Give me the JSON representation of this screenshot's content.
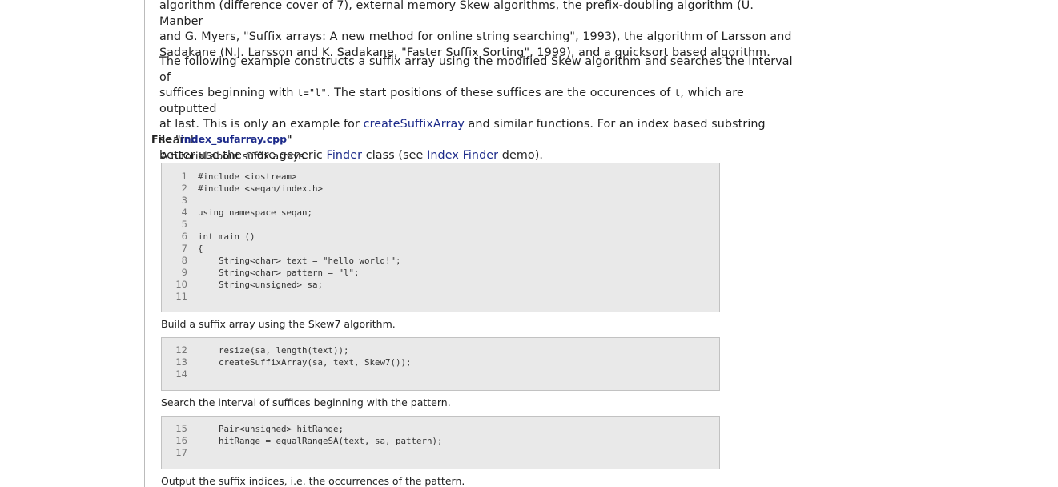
{
  "intro": {
    "para1": {
      "line1": "algorithm (difference cover of 7), external memory Skew algorithms, the prefix-doubling algorithm (U. Manber",
      "line2": "and G. Myers, \"Suffix arrays: A new method for online string searching\", 1993), the algorithm of Larsson and",
      "line3": "Sadakane (N.J. Larsson and K. Sadakane, \"Faster Suffix Sorting\", 1999), and a quicksort based algorithm."
    },
    "para2": {
      "t1": "The following example constructs a suffix array using the modified Skew algorithm and searches the interval of",
      "t2": "suffices beginning with ",
      "code1": "t=\"l\"",
      "t3": ". The start positions of these suffices are the occurences of ",
      "code2": "t",
      "t4": ", which are outputted",
      "t5": "at last. This is only an example for ",
      "link_create": "createSuffixArray",
      "t6": " and similar functions. For an index based substring search",
      "t7": "better use the more generic ",
      "link_finder": "Finder",
      "t8": " class (see ",
      "link_index_finder": "Index Finder",
      "t9": " demo)."
    }
  },
  "file": {
    "prefix": "File \"",
    "name": "index_sufarray.cpp",
    "suffix": "\""
  },
  "captions": [
    "A tutorial about suffix arrays.",
    "Build a suffix array using the Skew7 algorithm.",
    "Search the interval of suffices beginning with the pattern.",
    "Output the suffix indices, i.e. the occurrences of the pattern."
  ],
  "code_blocks": [
    {
      "lines": [
        {
          "n": "1",
          "code": "#include <iostream>"
        },
        {
          "n": "2",
          "code": "#include <seqan/index.h>"
        },
        {
          "n": "3",
          "code": ""
        },
        {
          "n": "4",
          "code": "using namespace seqan;"
        },
        {
          "n": "5",
          "code": ""
        },
        {
          "n": "6",
          "code": "int main ()"
        },
        {
          "n": "7",
          "code": "{"
        },
        {
          "n": "8",
          "code": "    String<char> text = \"hello world!\";"
        },
        {
          "n": "9",
          "code": "    String<char> pattern = \"l\";"
        },
        {
          "n": "10",
          "code": "    String<unsigned> sa;"
        },
        {
          "n": "11",
          "code": ""
        }
      ]
    },
    {
      "lines": [
        {
          "n": "12",
          "code": "    resize(sa, length(text));"
        },
        {
          "n": "13",
          "code": "    createSuffixArray(sa, text, Skew7());"
        },
        {
          "n": "14",
          "code": ""
        }
      ]
    },
    {
      "lines": [
        {
          "n": "15",
          "code": "    Pair<unsigned> hitRange;"
        },
        {
          "n": "16",
          "code": "    hitRange = equalRangeSA(text, sa, pattern);"
        },
        {
          "n": "17",
          "code": ""
        }
      ]
    }
  ]
}
